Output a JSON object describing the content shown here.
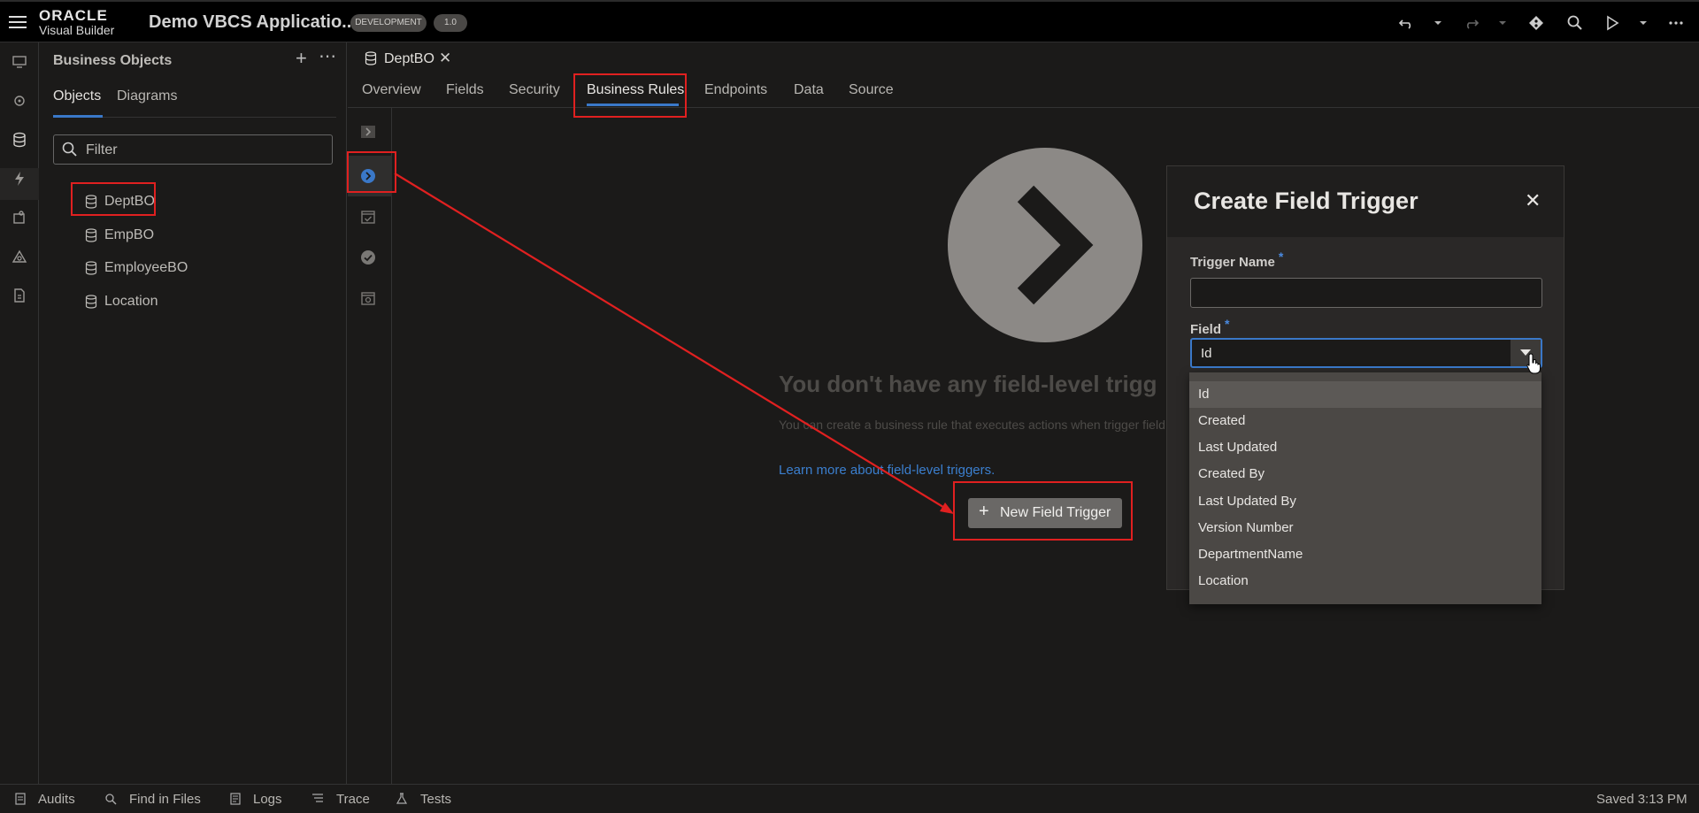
{
  "header": {
    "logo_line1": "ORACLE",
    "logo_line2": "Visual Builder",
    "app_title": "Demo VBCS Applicatio...",
    "env_badge": "DEVELOPMENT",
    "version_badge": "1.0"
  },
  "left_panel": {
    "title": "Business Objects",
    "tabs": [
      "Objects",
      "Diagrams"
    ],
    "filter_placeholder": "Filter",
    "items": [
      "DeptBO",
      "EmpBO",
      "EmployeeBO",
      "Location"
    ]
  },
  "editor": {
    "doc_tab": "DeptBO",
    "tabs": [
      "Overview",
      "Fields",
      "Security",
      "Business Rules",
      "Endpoints",
      "Data",
      "Source"
    ],
    "active_tab": "Business Rules"
  },
  "empty_state": {
    "title": "You don't have any field-level trigg",
    "description": "You can create a business rule that executes actions when trigger field.",
    "link": "Learn more about field-level triggers.",
    "button": "New Field Trigger"
  },
  "dialog": {
    "title": "Create Field Trigger",
    "trigger_name_label": "Trigger Name",
    "required_mark": "*",
    "trigger_name_value": "",
    "field_label": "Field",
    "field_value": "Id",
    "options": [
      "Id",
      "Created",
      "Last Updated",
      "Created By",
      "Last Updated By",
      "Version Number",
      "DepartmentName",
      "Location"
    ]
  },
  "status_bar": {
    "items": [
      "Audits",
      "Find in Files",
      "Logs",
      "Trace",
      "Tests"
    ],
    "saved": "Saved 3:13 PM"
  },
  "colors": {
    "accent": "#3a78c8",
    "highlight": "#e02020",
    "background": "#1b1a19"
  }
}
